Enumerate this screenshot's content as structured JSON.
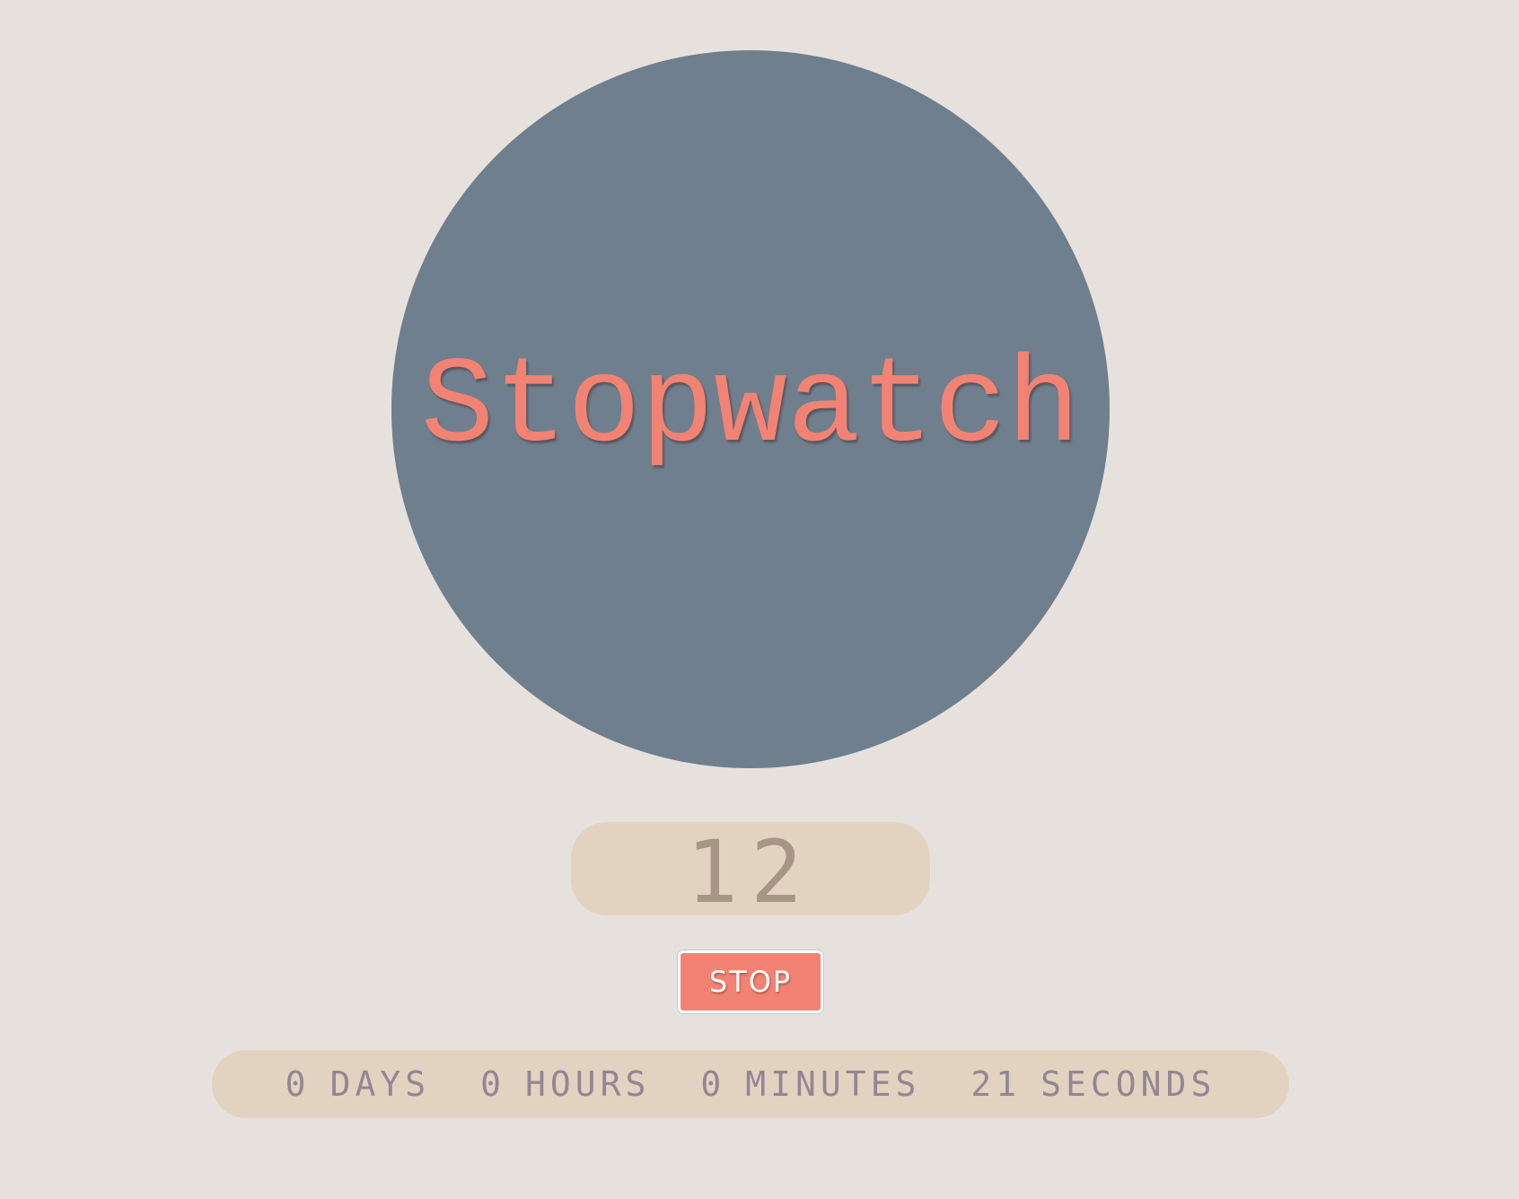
{
  "title": "Stopwatch",
  "counter": {
    "value": "12"
  },
  "controls": {
    "stop_label": "STOP"
  },
  "elapsed": {
    "days_value": "0",
    "days_unit": "DAYS",
    "hours_value": "0",
    "hours_unit": "HOURS",
    "minutes_value": "0",
    "minutes_unit": "MINUTES",
    "seconds_value": "21",
    "seconds_unit": "SECONDS"
  },
  "colors": {
    "background": "#e7e1de",
    "circle": "#707f8e",
    "accent": "#f28374",
    "panel": "#e2d3c1",
    "counter_text": "#a79586",
    "elapsed_text": "#948694"
  }
}
